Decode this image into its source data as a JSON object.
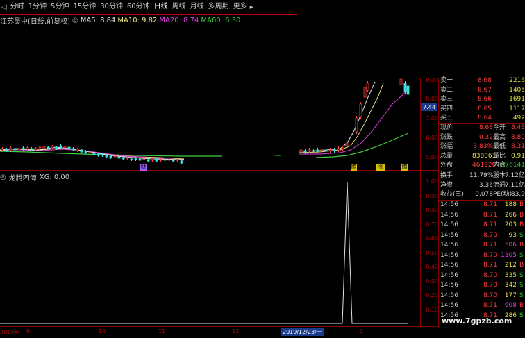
{
  "toolbar": {
    "items": [
      "分时",
      "1分钟",
      "5分钟",
      "15分钟",
      "30分钟",
      "60分钟",
      "日线",
      "周线",
      "月线",
      "多周期",
      "更多"
    ],
    "active_index": 6
  },
  "main_chart": {
    "stock_label": "江苏吴中(日线,前复权)",
    "ma5_label": "MA5: 8.84",
    "ma10_label": "MA10: 9.82",
    "ma20_label": "MA20: 8.74",
    "ma60_label": "MA60: 6.30",
    "price_marker": "7.44",
    "y_ticks": [
      "9.00",
      "8.00",
      "7.00",
      "6.00",
      "5.00"
    ],
    "event_marks": [
      "财",
      "腾",
      "涨跌",
      "腾"
    ]
  },
  "indicator": {
    "title": "龙腾四海",
    "value_label": "XG: 0.00",
    "y_ticks": [
      "1.00",
      "0.90",
      "0.80",
      "0.70",
      "0.60",
      "0.50",
      "0.40",
      "0.30",
      "0.20",
      "0.10"
    ]
  },
  "x_axis": [
    "2019年",
    "9",
    "10",
    "11",
    "12",
    "2019/12/23/一",
    "2"
  ],
  "order_book": [
    {
      "label": "卖一",
      "price": "8.68",
      "vol": "2216"
    },
    {
      "label": "卖二",
      "price": "8.67",
      "vol": "1405"
    },
    {
      "label": "卖三",
      "price": "8.66",
      "vol": "1691"
    },
    {
      "label": "买四",
      "price": "8.65",
      "vol": "1117"
    },
    {
      "label": "买五",
      "price": "8.64",
      "vol": "492"
    }
  ],
  "quote": [
    {
      "l1": "现价",
      "v1": "8.68",
      "l2": "今开",
      "v2": "8.43"
    },
    {
      "l1": "涨跌",
      "v1": "0.32",
      "l2": "最高",
      "v2": "8.80"
    },
    {
      "l1": "涨幅",
      "v1": "3.83%",
      "l2": "最低",
      "v2": "8.31"
    },
    {
      "l1": "总量",
      "v1": "838061",
      "l2": "量比",
      "v2": "0.91"
    },
    {
      "l1": "外盘",
      "v1": "461920",
      "l2": "内盘",
      "v2": "376141"
    }
  ],
  "stats": [
    {
      "l1": "换手",
      "v1": "11.79%",
      "l2": "股本",
      "v2": "7.12亿"
    },
    {
      "l1": "净资",
      "v1": "3.36",
      "l2": "流通",
      "v2": "7.11亿"
    },
    {
      "l1": "收益(三)",
      "v1": "0.078",
      "l2": "PE(动)",
      "v2": "83.9"
    }
  ],
  "ticks": [
    {
      "time": "14:56",
      "price": "8.71",
      "vol": "188",
      "side": "B"
    },
    {
      "time": "14:56",
      "price": "8.71",
      "vol": "266",
      "side": "B"
    },
    {
      "time": "14:56",
      "price": "8.71",
      "vol": "203",
      "side": "B"
    },
    {
      "time": "14:56",
      "price": "8.70",
      "vol": "93",
      "side": "S"
    },
    {
      "time": "14:56",
      "price": "8.71",
      "vol": "506",
      "side": "B"
    },
    {
      "time": "14:56",
      "price": "8.70",
      "vol": "1305",
      "side": "S"
    },
    {
      "time": "14:56",
      "price": "8.71",
      "vol": "212",
      "side": "B"
    },
    {
      "time": "14:56",
      "price": "8.70",
      "vol": "335",
      "side": "S"
    },
    {
      "time": "14:56",
      "price": "8.70",
      "vol": "342",
      "side": "S"
    },
    {
      "time": "14:56",
      "price": "8.70",
      "vol": "177",
      "side": "S"
    },
    {
      "time": "14:56",
      "price": "8.71",
      "vol": "608",
      "side": "B"
    },
    {
      "time": "14:56",
      "price": "8.71",
      "vol": "286",
      "side": "S"
    }
  ],
  "watermark": "www.7gpzb.com",
  "colors": {
    "up": "#ff4040",
    "down": "#30c030",
    "accent": "#c00000",
    "ma5": "#e8e8e8",
    "ma10": "#e8e080",
    "ma20": "#e040e0",
    "ma60": "#40d040"
  }
}
